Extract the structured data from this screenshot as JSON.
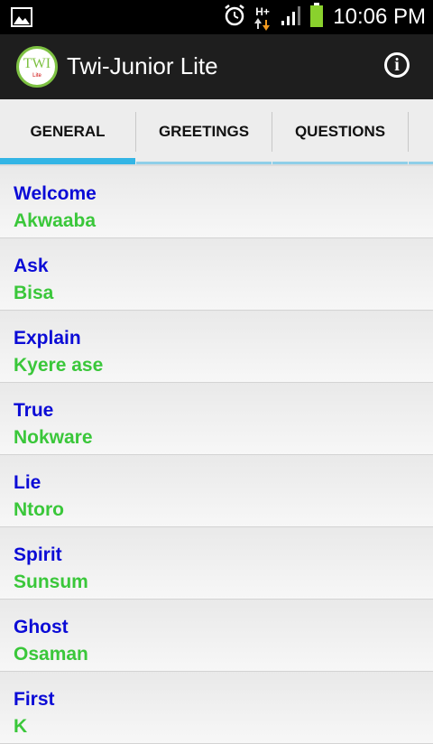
{
  "status_bar": {
    "time": "10:06 PM",
    "network": "H+",
    "icons": [
      "picture-icon",
      "alarm-icon",
      "data-arrows-icon",
      "signal-icon",
      "battery-icon"
    ]
  },
  "action_bar": {
    "logo_text": "TWI",
    "logo_subtext": "Lite",
    "title": "Twi-Junior Lite",
    "info_icon": "info-icon"
  },
  "tabs": [
    {
      "label": "GENERAL",
      "active": true
    },
    {
      "label": "GREETINGS",
      "active": false
    },
    {
      "label": "QUESTIONS",
      "active": false
    }
  ],
  "words": [
    {
      "english": "Welcome",
      "twi": "Akwaaba"
    },
    {
      "english": "Ask",
      "twi": "Bisa"
    },
    {
      "english": "Explain",
      "twi": "Kyere ase"
    },
    {
      "english": "True",
      "twi": "Nokware"
    },
    {
      "english": "Lie",
      "twi": "Ntoro"
    },
    {
      "english": "Spirit",
      "twi": "Sunsum"
    },
    {
      "english": "Ghost",
      "twi": "Osaman"
    },
    {
      "english": "First",
      "twi": "K"
    }
  ],
  "colors": {
    "english_text": "#0b0bd6",
    "twi_text": "#3ac73a",
    "tab_indicator": "#33b5e5",
    "action_bar": "#1e1e1e"
  }
}
